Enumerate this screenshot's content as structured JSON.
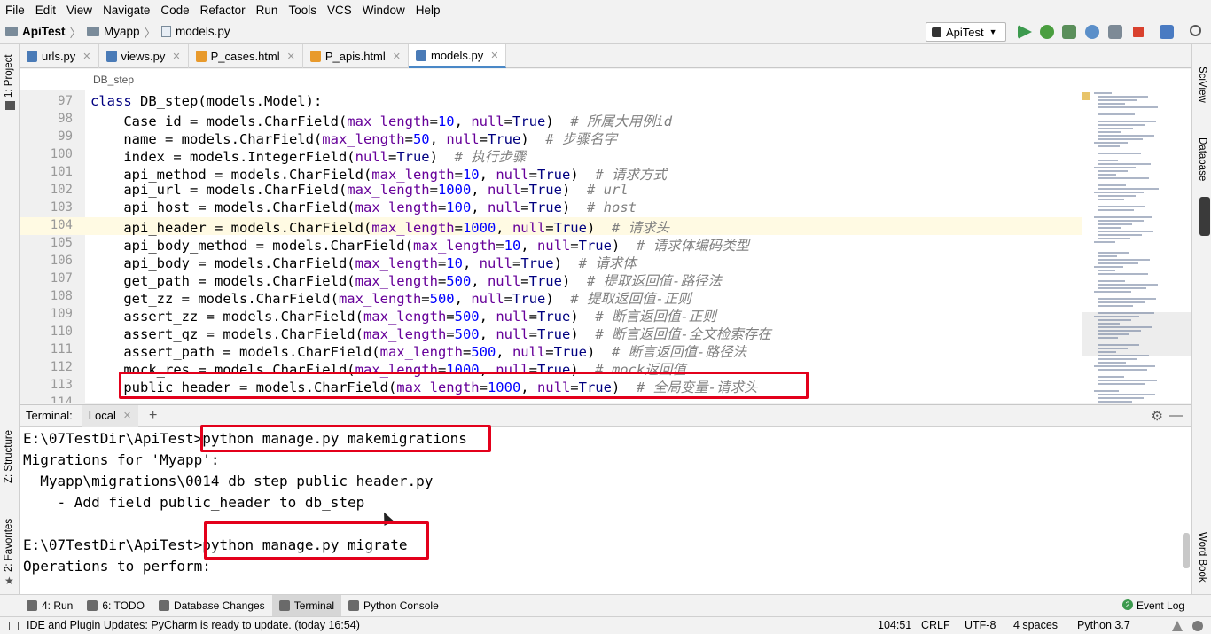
{
  "menu": [
    "File",
    "Edit",
    "View",
    "Navigate",
    "Code",
    "Refactor",
    "Run",
    "Tools",
    "VCS",
    "Window",
    "Help"
  ],
  "nav": {
    "project": "ApiTest",
    "folder": "Myapp",
    "file": "models.py",
    "run_config": "ApiTest"
  },
  "sidebar_left": {
    "project": "1: Project",
    "structure": "Z: Structure",
    "favorites": "2: Favorites"
  },
  "sidebar_right": {
    "sciview": "SciView",
    "database": "Database",
    "wordbook": "Word Book"
  },
  "tabs": [
    {
      "label": "urls.py",
      "icon": "python-file-icon",
      "color": "#4a7bb7"
    },
    {
      "label": "views.py",
      "icon": "python-file-icon",
      "color": "#4a7bb7"
    },
    {
      "label": "P_cases.html",
      "icon": "html-file-icon",
      "color": "#e89a2c"
    },
    {
      "label": "P_apis.html",
      "icon": "html-file-icon",
      "color": "#e89a2c"
    },
    {
      "label": "models.py",
      "icon": "python-file-icon",
      "color": "#4a7bb7",
      "active": true
    }
  ],
  "editor_breadcrumb": "DB_step",
  "code": {
    "line_numbers": [
      "97",
      "98",
      "99",
      "100",
      "101",
      "102",
      "103",
      "104",
      "105",
      "106",
      "107",
      "108",
      "109",
      "110",
      "111",
      "112",
      "113",
      "114"
    ],
    "current_line": "104",
    "lines": [
      {
        "indent": "",
        "name": "class",
        "rest": " DB_step(models.Model):",
        "comment": "",
        "is_class": true
      },
      {
        "indent": "    ",
        "name": "Case_id",
        "rest": " = models.CharField(max_length=10, null=True)  ",
        "comment": "# 所属大用例id"
      },
      {
        "indent": "    ",
        "name": "name",
        "rest": " = models.CharField(max_length=50, null=True)  ",
        "comment": "# 步骤名字"
      },
      {
        "indent": "    ",
        "name": "index",
        "rest": " = models.IntegerField(null=True)  ",
        "comment": "# 执行步骤"
      },
      {
        "indent": "    ",
        "name": "api_method",
        "rest": " = models.CharField(max_length=10, null=True)  ",
        "comment": "# 请求方式"
      },
      {
        "indent": "    ",
        "name": "api_url",
        "rest": " = models.CharField(max_length=1000, null=True)  ",
        "comment": "# url"
      },
      {
        "indent": "    ",
        "name": "api_host",
        "rest": " = models.CharField(max_length=100, null=True)  ",
        "comment": "# host"
      },
      {
        "indent": "    ",
        "name": "api_header",
        "rest": " = models.CharField(max_length=1000, null=True)  ",
        "comment": "# 请求头"
      },
      {
        "indent": "    ",
        "name": "api_body_method",
        "rest": " = models.CharField(max_length=10, null=True)  ",
        "comment": "# 请求体编码类型"
      },
      {
        "indent": "    ",
        "name": "api_body",
        "rest": " = models.CharField(max_length=10, null=True)  ",
        "comment": "# 请求体"
      },
      {
        "indent": "    ",
        "name": "get_path",
        "rest": " = models.CharField(max_length=500, null=True)  ",
        "comment": "# 提取返回值-路径法"
      },
      {
        "indent": "    ",
        "name": "get_zz",
        "rest": " = models.CharField(max_length=500, null=True)  ",
        "comment": "# 提取返回值-正则"
      },
      {
        "indent": "    ",
        "name": "assert_zz",
        "rest": " = models.CharField(max_length=500, null=True)  ",
        "comment": "# 断言返回值-正则"
      },
      {
        "indent": "    ",
        "name": "assert_qz",
        "rest": " = models.CharField(max_length=500, null=True)  ",
        "comment": "# 断言返回值-全文检索存在"
      },
      {
        "indent": "    ",
        "name": "assert_path",
        "rest": " = models.CharField(max_length=500, null=True)  ",
        "comment": "# 断言返回值-路径法"
      },
      {
        "indent": "    ",
        "name": "mock_res",
        "rest": " = models.CharField(max_length=1000, null=True)  ",
        "comment": "# mock返回值"
      },
      {
        "indent": "    ",
        "name": "public_header",
        "rest": " = models.CharField(max_length=1000, null=True)  ",
        "comment": "# 全局变量-请求头"
      }
    ]
  },
  "terminal": {
    "label": "Terminal:",
    "tab": "Local",
    "lines": [
      "E:\\07TestDir\\ApiTest>python manage.py makemigrations",
      "Migrations for 'Myapp':",
      "  Myapp\\migrations\\0014_db_step_public_header.py",
      "    - Add field public_header to db_step",
      "",
      "E:\\07TestDir\\ApiTest>python manage.py migrate",
      "Operations to perform:"
    ]
  },
  "bottom_tools": [
    {
      "label": "4: Run",
      "icon": "run-icon"
    },
    {
      "label": "6: TODO",
      "icon": "todo-icon"
    },
    {
      "label": "Database Changes",
      "icon": "database-icon"
    },
    {
      "label": "Terminal",
      "icon": "terminal-icon",
      "active": true
    },
    {
      "label": "Python Console",
      "icon": "python-console-icon"
    }
  ],
  "event_log": {
    "count": "2",
    "label": "Event Log"
  },
  "status": {
    "message": "IDE and Plugin Updates: PyCharm is ready to update. (today 16:54)",
    "position": "104:51",
    "line_sep": "CRLF",
    "encoding": "UTF-8",
    "indent": "4 spaces",
    "interpreter": "Python 3.7"
  },
  "colors": {
    "accent": "#4a88c7",
    "annotation": "#e3001b",
    "keyword": "#000080",
    "comment": "#808080",
    "kwarg": "#660099",
    "number": "#0000ff"
  }
}
